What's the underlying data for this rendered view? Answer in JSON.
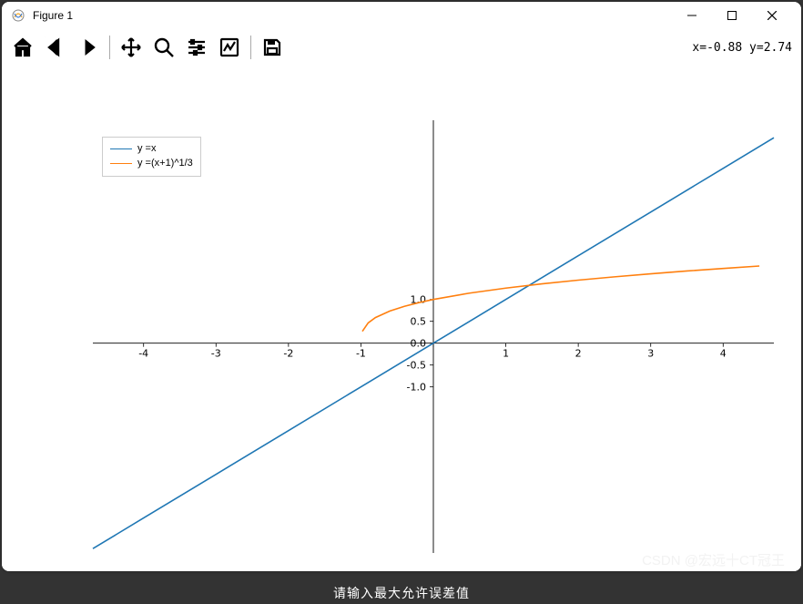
{
  "window": {
    "title": "Figure 1"
  },
  "toolbar": {
    "home": "home",
    "back": "back",
    "forward": "forward",
    "pan": "pan",
    "zoom": "zoom",
    "configure": "configure",
    "edit": "edit",
    "save": "save"
  },
  "status": {
    "coord_text": "x=-0.88 y=2.74"
  },
  "legend": {
    "items": [
      {
        "label": "y =x",
        "color": "#1f77b4"
      },
      {
        "label": "y =(x+1)^1/3",
        "color": "#ff7f0e"
      }
    ]
  },
  "watermark": "CSDN @宏远十CT冠王",
  "footer": "请输入最大允许误差值",
  "chart_data": {
    "type": "line",
    "title": "",
    "xlabel": "",
    "ylabel": "",
    "xlim": [
      -4.7,
      4.7
    ],
    "ylim": [
      -4.8,
      5.1
    ],
    "xticks": [
      -4,
      -3,
      -2,
      -1,
      0,
      1,
      2,
      3,
      4
    ],
    "yticks": [
      -1.0,
      -0.5,
      0.0,
      0.5,
      1.0
    ],
    "legend_loc": "upper left",
    "series": [
      {
        "name": "y =x",
        "color": "#1f77b4",
        "x": [
          -4.7,
          -4,
          -3,
          -2,
          -1,
          0,
          1,
          2,
          3,
          4,
          4.7
        ],
        "y": [
          -4.7,
          -4,
          -3,
          -2,
          -1,
          0,
          1,
          2,
          3,
          4,
          4.7
        ]
      },
      {
        "name": "y =(x+1)^1/3",
        "color": "#ff7f0e",
        "x": [
          -0.98,
          -0.9,
          -0.8,
          -0.6,
          -0.4,
          -0.2,
          0,
          0.5,
          1,
          1.5,
          2,
          2.5,
          3,
          3.5,
          4,
          4.5
        ],
        "y": [
          0.271,
          0.464,
          0.585,
          0.737,
          0.843,
          0.928,
          1.0,
          1.145,
          1.26,
          1.357,
          1.442,
          1.518,
          1.587,
          1.651,
          1.71,
          1.765
        ]
      }
    ]
  }
}
